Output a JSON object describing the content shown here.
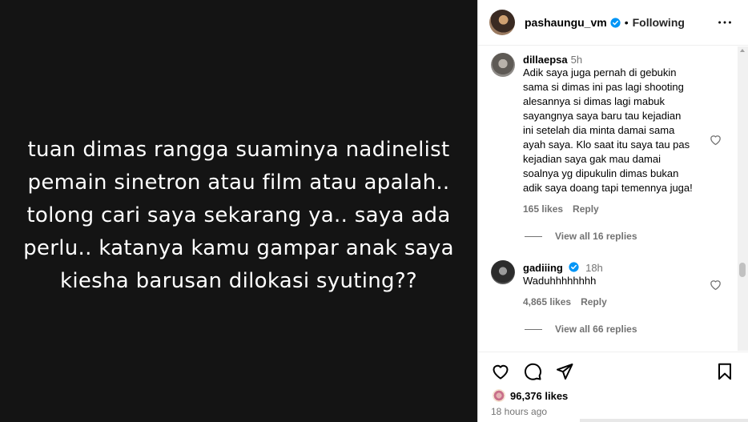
{
  "post": {
    "caption": "tuan dimas rangga suaminya nadinelist pemain sinetron atau film atau apalah.. tolong cari saya sekarang ya.. saya ada perlu.. katanya kamu gampar anak saya kiesha barusan dilokasi syuting??",
    "background_color": "#141414"
  },
  "header": {
    "username": "pashaungu_vm",
    "verified": true,
    "separator": "•",
    "follow_status": "Following",
    "more_icon": "more-horizontal-icon"
  },
  "comments": [
    {
      "username": "dillaepsa",
      "verified": false,
      "time": "5h",
      "text": "Adik saya juga pernah di gebukin sama si dimas ini pas lagi shooting alesannya si dimas lagi mabuk sayangnya saya baru tau kejadian ini setelah dia minta damai sama ayah saya. Klo saat itu saya tau pas kejadian saya gak mau damai soalnya yg dipukulin dimas bukan adik saya doang tapi temennya juga!",
      "likes": "165 likes",
      "reply_label": "Reply",
      "view_replies": "View all 16 replies"
    },
    {
      "username": "gadiiing",
      "verified": true,
      "time": "18h",
      "text": "Waduhhhhhhhh",
      "likes": "4,865 likes",
      "reply_label": "Reply",
      "view_replies": "View all 66 replies"
    }
  ],
  "actions": {
    "icons": [
      "heart-icon",
      "comment-icon",
      "share-icon",
      "bookmark-icon"
    ],
    "likes_count": "96,376 likes",
    "time_ago": "18 hours ago"
  },
  "colors": {
    "verified_blue": "#0095f6",
    "secondary_text": "#737373"
  }
}
